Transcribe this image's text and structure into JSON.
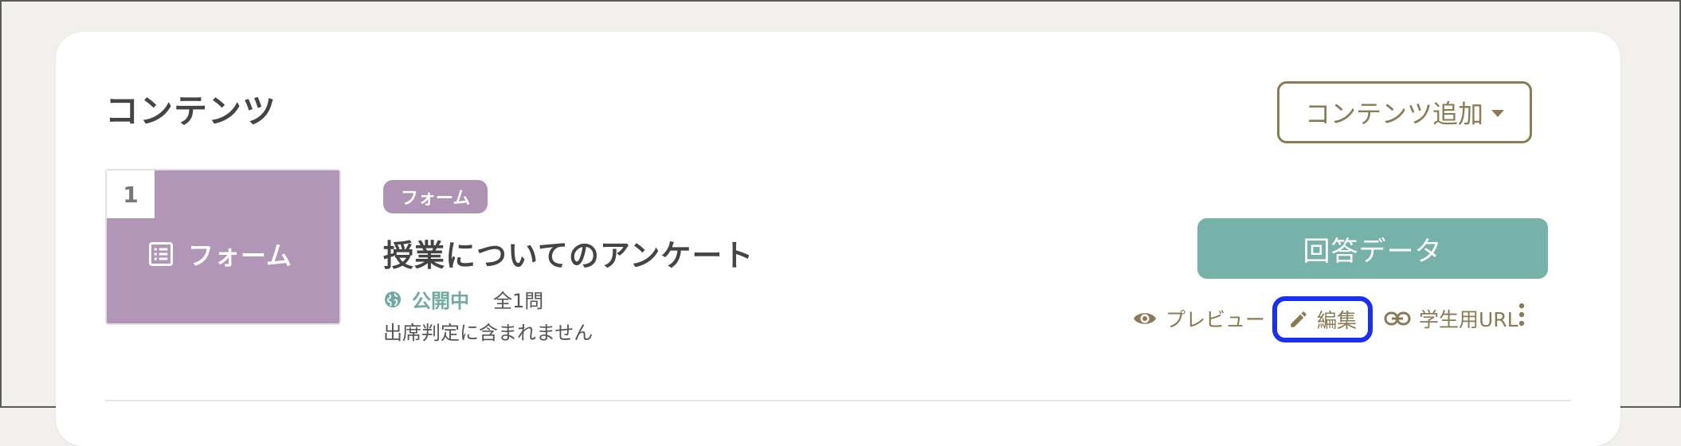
{
  "section": {
    "title": "コンテンツ",
    "add_button_label": "コンテンツ追加"
  },
  "item": {
    "number": "1",
    "thumbnail_label": "フォーム",
    "type_badge": "フォーム",
    "title": "授業についてのアンケート",
    "status": "公開中",
    "question_count": "全1問",
    "attendance_note": "出席判定に含まれません",
    "answer_button_label": "回答データ",
    "actions": {
      "preview": "プレビュー",
      "edit": "編集",
      "student_url": "学生用URL"
    }
  },
  "icons": {
    "thumbnail": "form-list-icon",
    "status": "globe-icon",
    "preview": "eye-icon",
    "edit": "pencil-icon",
    "student_url": "link-icon",
    "more": "more-vertical-icon",
    "add_dropdown": "caret-down-icon"
  },
  "colors": {
    "accent": "#8a7b55",
    "form_purple": "#b196b8",
    "teal": "#76b1aa",
    "status_teal": "#72aaa0",
    "highlight_blue": "#1a2ff0"
  }
}
